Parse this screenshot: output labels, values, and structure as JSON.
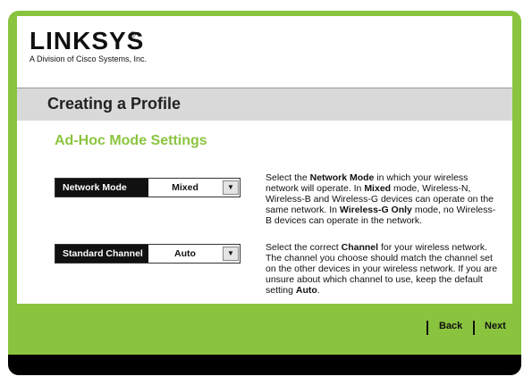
{
  "brand": {
    "logo": "LINKSYS",
    "registered": "®",
    "tagline": "A Division of Cisco Systems, Inc."
  },
  "page_title": "Creating a Profile",
  "section_title": "Ad-Hoc Mode Settings",
  "network_mode": {
    "label": "Network Mode",
    "value": "Mixed"
  },
  "standard_channel": {
    "label": "Standard Channel",
    "value": "Auto"
  },
  "help": {
    "network_mode": {
      "p1": "Select the ",
      "b1": "Network Mode",
      "p2": " in which your wireless network will operate. In ",
      "b2": "Mixed",
      "p3": " mode, Wireless-N, Wireless-B and Wireless-G devices can operate on the same network. In ",
      "b3": "Wireless-G Only",
      "p4": " mode, no Wireless-B devices can operate in the network."
    },
    "channel": {
      "p1": "Select the correct ",
      "b1": "Channel",
      "p2": " for your wireless network. The channel you choose should match the channel set on the other devices in your wireless network. If you are unsure about which channel to use, keep the default setting ",
      "b2": "Auto",
      "p3": "."
    }
  },
  "nav": {
    "back": "Back",
    "next": "Next"
  },
  "colors": {
    "accent": "#8ac43f",
    "titlebar": "#d9d9d9",
    "footer": "#000000"
  },
  "icons": {
    "dropdown": "chevron-down-icon"
  }
}
